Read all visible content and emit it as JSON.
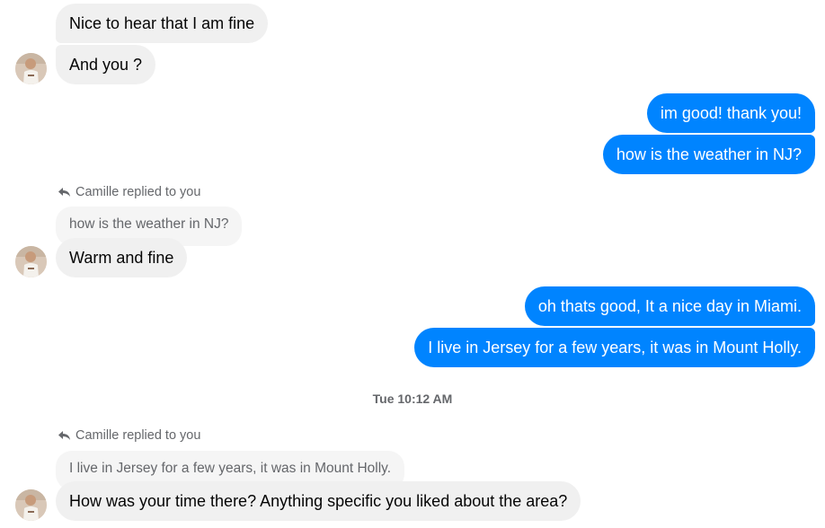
{
  "conversation": {
    "messages": [
      {
        "sender": "them",
        "text": "Nice to hear that I am fine"
      },
      {
        "sender": "them",
        "text": "And you ?"
      },
      {
        "sender": "me",
        "text": "im good!  thank you!"
      },
      {
        "sender": "me",
        "text": "how is the weather in NJ?"
      },
      {
        "sender": "them",
        "reply_label": "Camille replied to you",
        "quoted_text": "how is the weather in NJ?",
        "text": "Warm and fine"
      },
      {
        "sender": "me",
        "text": "oh thats good, It a nice day in Miami."
      },
      {
        "sender": "me",
        "text": "I live in Jersey for a few years, it was in Mount Holly."
      },
      {
        "sender": "them",
        "reply_label": "Camille replied to you",
        "quoted_text": "I live in Jersey for a few years, it was in Mount Holly.",
        "text": "How was your time there? Anything specific you liked about the area?"
      }
    ],
    "timestamp": "Tue 10:12 AM"
  },
  "colors": {
    "outgoing_bubble": "#0084ff",
    "incoming_bubble": "#f0f0f0",
    "quoted_bubble": "#f5f5f5",
    "secondary_text": "#65676b"
  },
  "icons": {
    "reply": "reply-arrow-icon",
    "avatar": "contact-avatar"
  }
}
